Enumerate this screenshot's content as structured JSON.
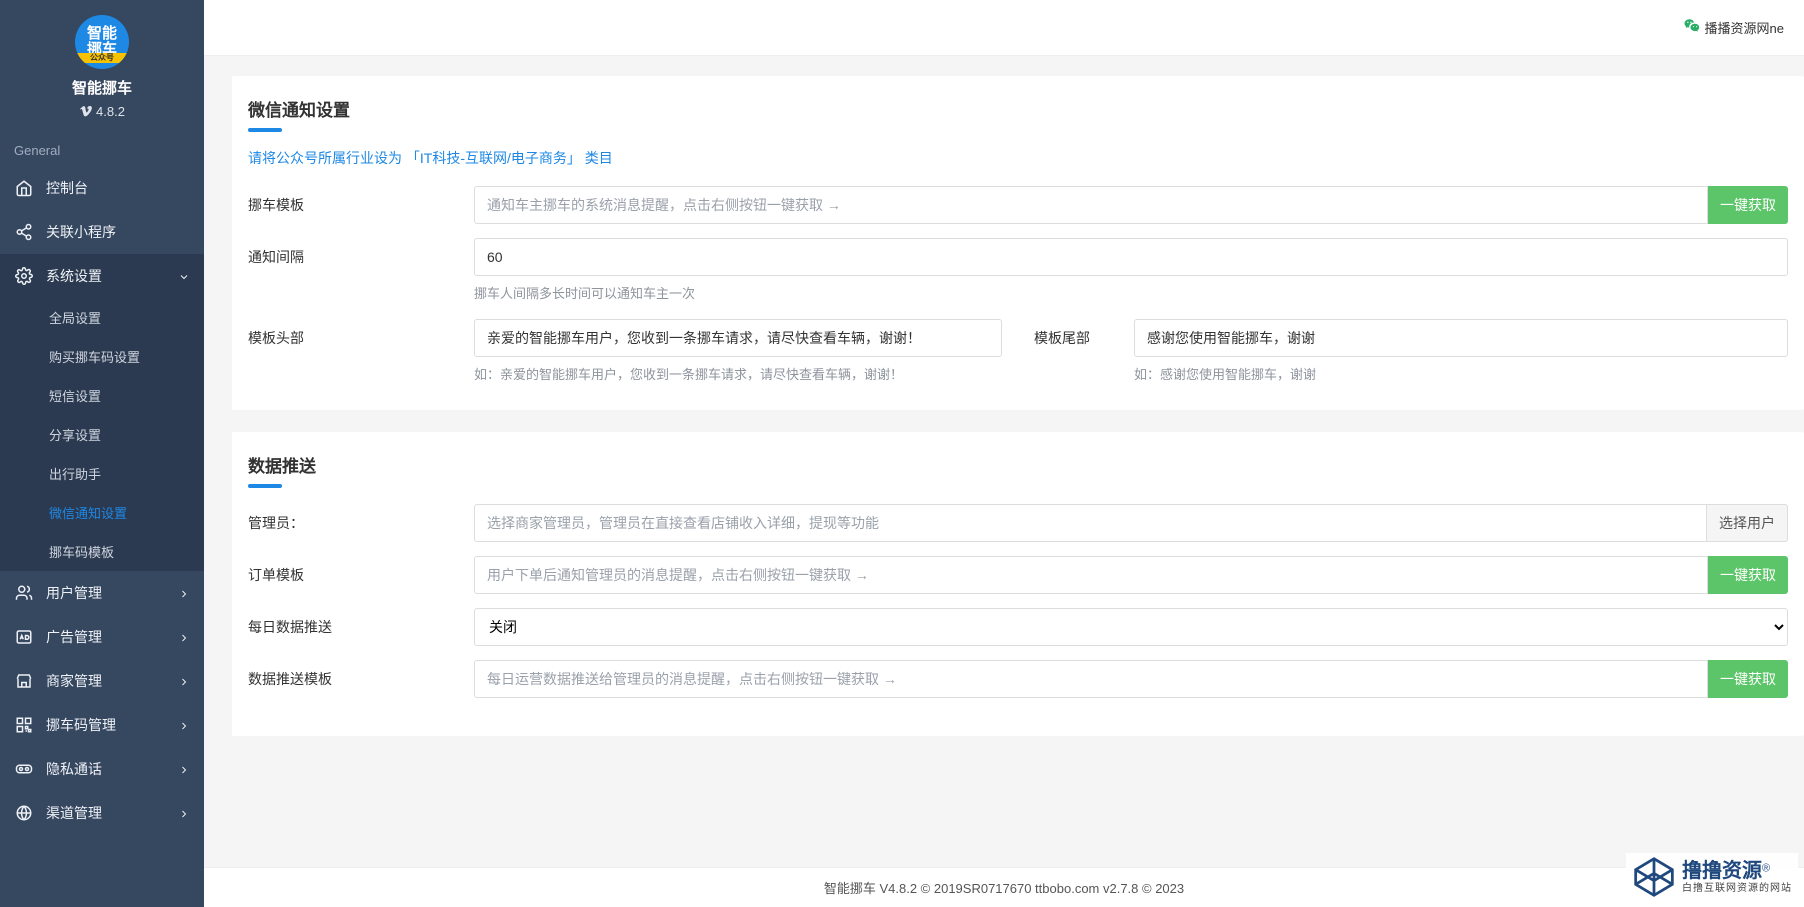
{
  "app": {
    "name": "智能挪车",
    "version_prefix": "V",
    "version": "4.8.2",
    "logo_text": "智能\n挪车",
    "logo_band": "公众号"
  },
  "topbar": {
    "link_text": "播播资源网ne"
  },
  "sidebar": {
    "section": "General",
    "items": [
      {
        "key": "dashboard",
        "label": "控制台"
      },
      {
        "key": "miniapp",
        "label": "关联小程序"
      },
      {
        "key": "system",
        "label": "系统设置",
        "expanded": true,
        "children": [
          {
            "key": "global",
            "label": "全局设置"
          },
          {
            "key": "buycode",
            "label": "购买挪车码设置"
          },
          {
            "key": "sms",
            "label": "短信设置"
          },
          {
            "key": "share",
            "label": "分享设置"
          },
          {
            "key": "travel",
            "label": "出行助手"
          },
          {
            "key": "wechat",
            "label": "微信通知设置",
            "active": true
          },
          {
            "key": "template",
            "label": "挪车码模板"
          }
        ]
      },
      {
        "key": "user",
        "label": "用户管理",
        "chev": true
      },
      {
        "key": "ad",
        "label": "广告管理",
        "chev": true
      },
      {
        "key": "merchant",
        "label": "商家管理",
        "chev": true
      },
      {
        "key": "codemgr",
        "label": "挪车码管理",
        "chev": true
      },
      {
        "key": "privacy",
        "label": "隐私通话",
        "chev": true
      },
      {
        "key": "channel",
        "label": "渠道管理",
        "chev": true
      }
    ]
  },
  "section_wechat": {
    "title": "微信通知设置",
    "note": "请将公众号所属行业设为 「IT科技-互联网/电子商务」 类目",
    "move_template": {
      "label": "挪车模板",
      "placeholder": "通知车主挪车的系统消息提醒，点击右侧按钮一键获取 →",
      "button": "一键获取"
    },
    "interval": {
      "label": "通知间隔",
      "value": "60",
      "hint": "挪车人间隔多长时间可以通知车主一次"
    },
    "head": {
      "label": "模板头部",
      "value": "亲爱的智能挪车用户，您收到一条挪车请求，请尽快查看车辆，谢谢！",
      "hint": "如：亲爱的智能挪车用户，您收到一条挪车请求，请尽快查看车辆，谢谢！"
    },
    "tail": {
      "label": "模板尾部",
      "value": "感谢您使用智能挪车，谢谢",
      "hint": "如：感谢您使用智能挪车，谢谢"
    }
  },
  "section_push": {
    "title": "数据推送",
    "admin": {
      "label": "管理员：",
      "placeholder": "选择商家管理员，管理员在直接查看店铺收入详细，提现等功能",
      "button": "选择用户"
    },
    "order_template": {
      "label": "订单模板",
      "placeholder": "用户下单后通知管理员的消息提醒，点击右侧按钮一键获取 →",
      "button": "一键获取"
    },
    "daily_push": {
      "label": "每日数据推送",
      "value": "关闭"
    },
    "push_template": {
      "label": "数据推送模板",
      "placeholder": "每日运营数据推送给管理员的消息提醒，点击右侧按钮一键获取 →",
      "button": "一键获取"
    }
  },
  "footer": {
    "text": "智能挪车 V4.8.2 © 2019SR0717670 ttbobo.com v2.7.8 © 2023"
  },
  "watermark": {
    "main": "撸撸资源",
    "reg": "®",
    "sub": "白撸互联网资源的网站"
  }
}
